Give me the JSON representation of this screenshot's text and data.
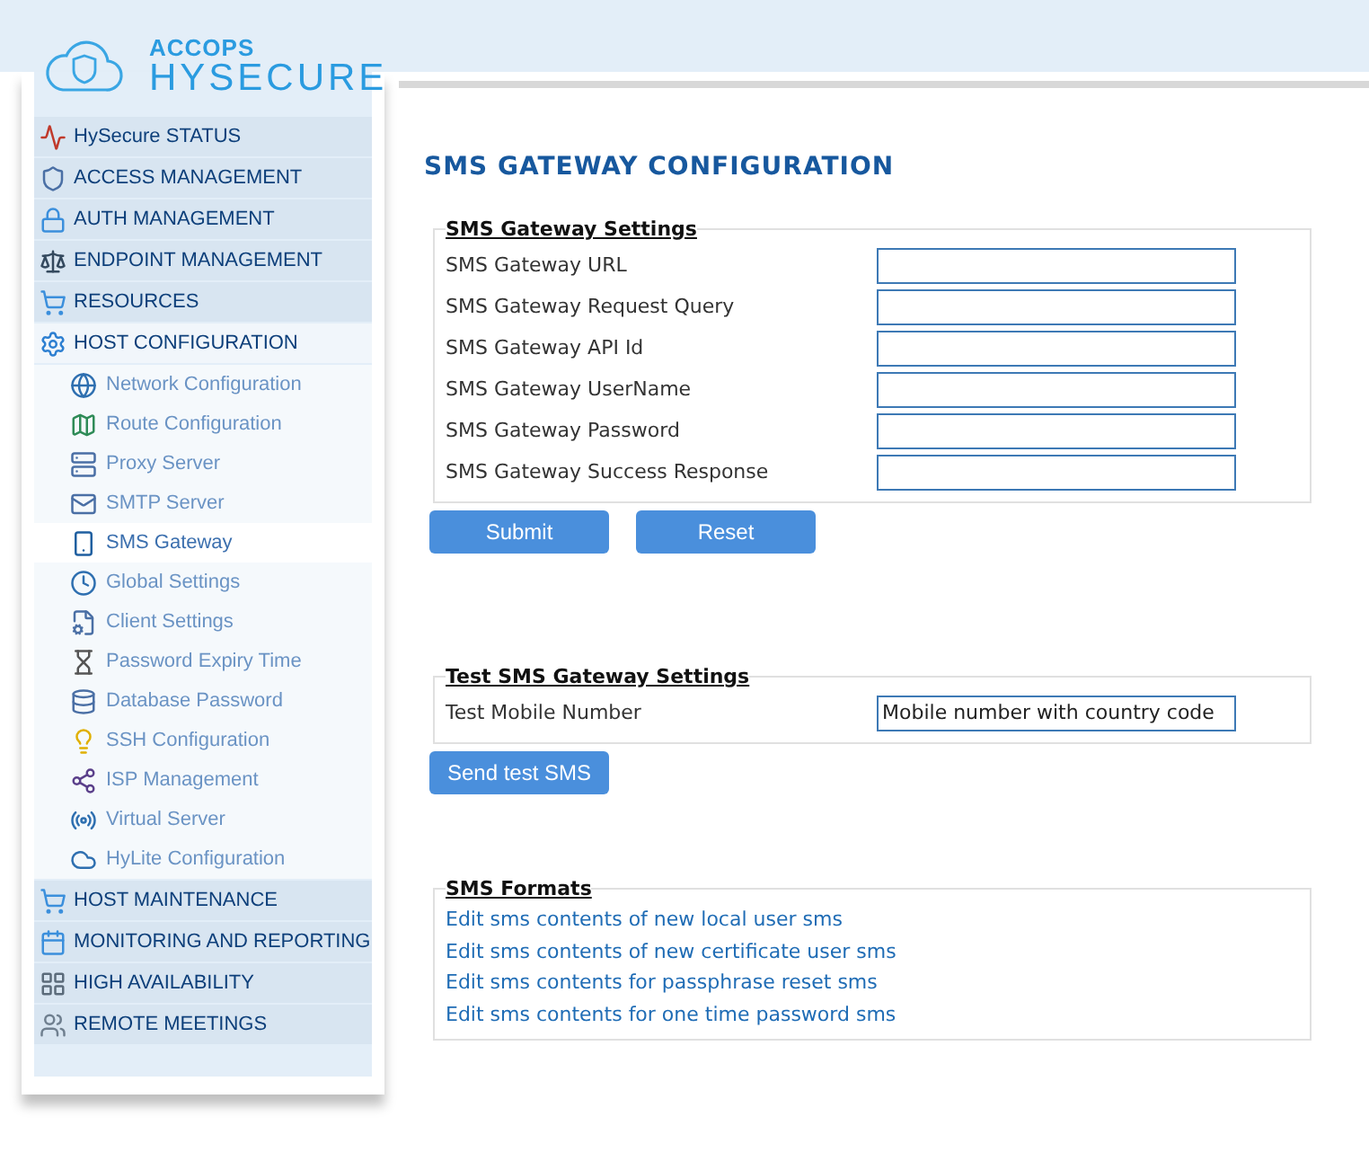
{
  "logo": {
    "brand": "ACCOPS",
    "product": "HYSECURE"
  },
  "sidebar": {
    "items": [
      {
        "label": "HySecure STATUS",
        "expanded": false
      },
      {
        "label": "ACCESS MANAGEMENT",
        "expanded": false
      },
      {
        "label": "AUTH MANAGEMENT",
        "expanded": false
      },
      {
        "label": "ENDPOINT MANAGEMENT",
        "expanded": false
      },
      {
        "label": "RESOURCES",
        "expanded": false
      },
      {
        "label": "HOST CONFIGURATION",
        "expanded": true,
        "children": [
          {
            "label": "Network Configuration",
            "selected": false
          },
          {
            "label": "Route Configuration",
            "selected": false
          },
          {
            "label": "Proxy Server",
            "selected": false
          },
          {
            "label": "SMTP Server",
            "selected": false
          },
          {
            "label": "SMS Gateway",
            "selected": true
          },
          {
            "label": "Global Settings",
            "selected": false
          },
          {
            "label": "Client Settings",
            "selected": false
          },
          {
            "label": "Password Expiry Time",
            "selected": false
          },
          {
            "label": "Database Password",
            "selected": false
          },
          {
            "label": "SSH Configuration",
            "selected": false
          },
          {
            "label": "ISP Management",
            "selected": false
          },
          {
            "label": "Virtual Server",
            "selected": false
          },
          {
            "label": "HyLite Configuration",
            "selected": false
          }
        ]
      },
      {
        "label": "HOST MAINTENANCE",
        "expanded": false
      },
      {
        "label": "MONITORING AND REPORTING",
        "expanded": false
      },
      {
        "label": "HIGH AVAILABILITY",
        "expanded": false
      },
      {
        "label": "REMOTE MEETINGS",
        "expanded": false
      }
    ]
  },
  "title": "SMS GATEWAY CONFIGURATION",
  "gateway_settings": {
    "legend": "SMS Gateway Settings",
    "fields": [
      {
        "label": "SMS Gateway URL"
      },
      {
        "label": "SMS Gateway Request Query"
      },
      {
        "label": "SMS Gateway API Id"
      },
      {
        "label": "SMS Gateway UserName"
      },
      {
        "label": "SMS Gateway Password"
      },
      {
        "label": "SMS Gateway Success Response"
      }
    ],
    "buttons": [
      "Submit",
      "Reset"
    ]
  },
  "test_settings": {
    "legend": "Test SMS Gateway Settings",
    "fields": [
      {
        "label": "Test Mobile Number",
        "value": "Mobile number with country code"
      }
    ],
    "buttons": [
      "Send test SMS"
    ]
  },
  "sms_formats": {
    "legend": "SMS Formats",
    "links": [
      "Edit sms contents of new local user sms",
      "Edit sms contents of new certificate user sms",
      "Edit sms contents for passphrase reset sms",
      "Edit sms contents for one time password sms"
    ]
  }
}
